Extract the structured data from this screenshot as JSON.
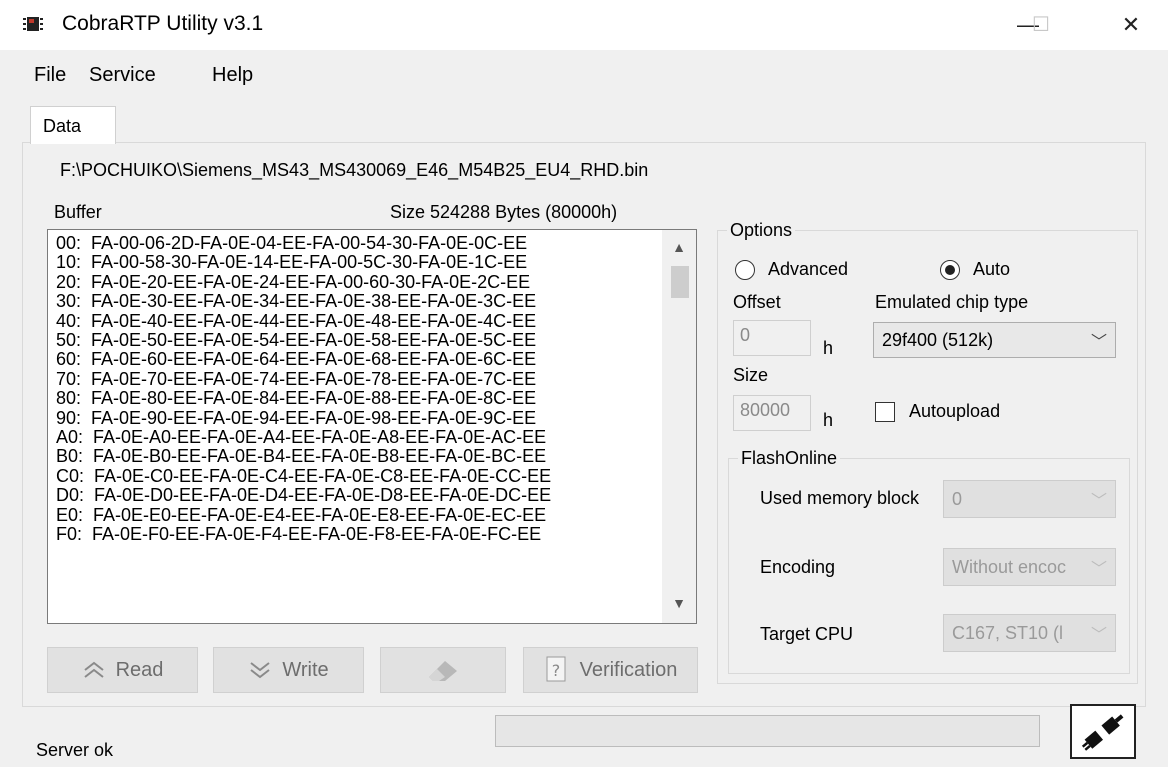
{
  "window": {
    "title": "CobraRTP Utility v3.1",
    "minimize": "—",
    "maximize": "☐",
    "close": "✕"
  },
  "menu": [
    "File",
    "Service",
    "Help"
  ],
  "tab": {
    "label": "Data"
  },
  "file_path": "F:\\POCHUIKO\\Siemens_MS43_MS430069_E46_M54B25_EU4_RHD.bin",
  "buffer": {
    "label": "Buffer",
    "size_label": "Size 524288 Bytes (80000h)",
    "lines": [
      "00:  FA-00-06-2D-FA-0E-04-EE-FA-00-54-30-FA-0E-0C-EE",
      "10:  FA-00-58-30-FA-0E-14-EE-FA-00-5C-30-FA-0E-1C-EE",
      "20:  FA-0E-20-EE-FA-0E-24-EE-FA-00-60-30-FA-0E-2C-EE",
      "30:  FA-0E-30-EE-FA-0E-34-EE-FA-0E-38-EE-FA-0E-3C-EE",
      "40:  FA-0E-40-EE-FA-0E-44-EE-FA-0E-48-EE-FA-0E-4C-EE",
      "50:  FA-0E-50-EE-FA-0E-54-EE-FA-0E-58-EE-FA-0E-5C-EE",
      "60:  FA-0E-60-EE-FA-0E-64-EE-FA-0E-68-EE-FA-0E-6C-EE",
      "70:  FA-0E-70-EE-FA-0E-74-EE-FA-0E-78-EE-FA-0E-7C-EE",
      "80:  FA-0E-80-EE-FA-0E-84-EE-FA-0E-88-EE-FA-0E-8C-EE",
      "90:  FA-0E-90-EE-FA-0E-94-EE-FA-0E-98-EE-FA-0E-9C-EE",
      "A0:  FA-0E-A0-EE-FA-0E-A4-EE-FA-0E-A8-EE-FA-0E-AC-EE",
      "B0:  FA-0E-B0-EE-FA-0E-B4-EE-FA-0E-B8-EE-FA-0E-BC-EE",
      "C0:  FA-0E-C0-EE-FA-0E-C4-EE-FA-0E-C8-EE-FA-0E-CC-EE",
      "D0:  FA-0E-D0-EE-FA-0E-D4-EE-FA-0E-D8-EE-FA-0E-DC-EE",
      "E0:  FA-0E-E0-EE-FA-0E-E4-EE-FA-0E-E8-EE-FA-0E-EC-EE",
      "F0:  FA-0E-F0-EE-FA-0E-F4-EE-FA-0E-F8-EE-FA-0E-FC-EE"
    ]
  },
  "buttons": {
    "read": "Read",
    "write": "Write",
    "verification": "Verification"
  },
  "options": {
    "title": "Options",
    "advanced": "Advanced",
    "auto": "Auto",
    "mode_selected": "Auto",
    "offset_label": "Offset",
    "offset_value": "0",
    "size_label": "Size",
    "size_value": "80000",
    "h_suffix": "h",
    "chip_label": "Emulated chip type",
    "chip_value": "29f400 (512k)",
    "autoupload": "Autoupload",
    "autoupload_checked": false
  },
  "flash_online": {
    "title": "FlashOnline",
    "memory_block_label": "Used memory block",
    "memory_block_value": "0",
    "encoding_label": "Encoding",
    "encoding_value": "Without encoc",
    "cpu_label": "Target CPU",
    "cpu_value": "C167, ST10 (l"
  },
  "status": {
    "text": "Server ok",
    "progress": 0
  },
  "icons": {
    "app": "chip-icon",
    "read": "double-chevron-up-icon",
    "write": "double-chevron-down-icon",
    "erase": "eraser-icon",
    "verify": "question-document-icon",
    "connection": "plug-icon"
  }
}
